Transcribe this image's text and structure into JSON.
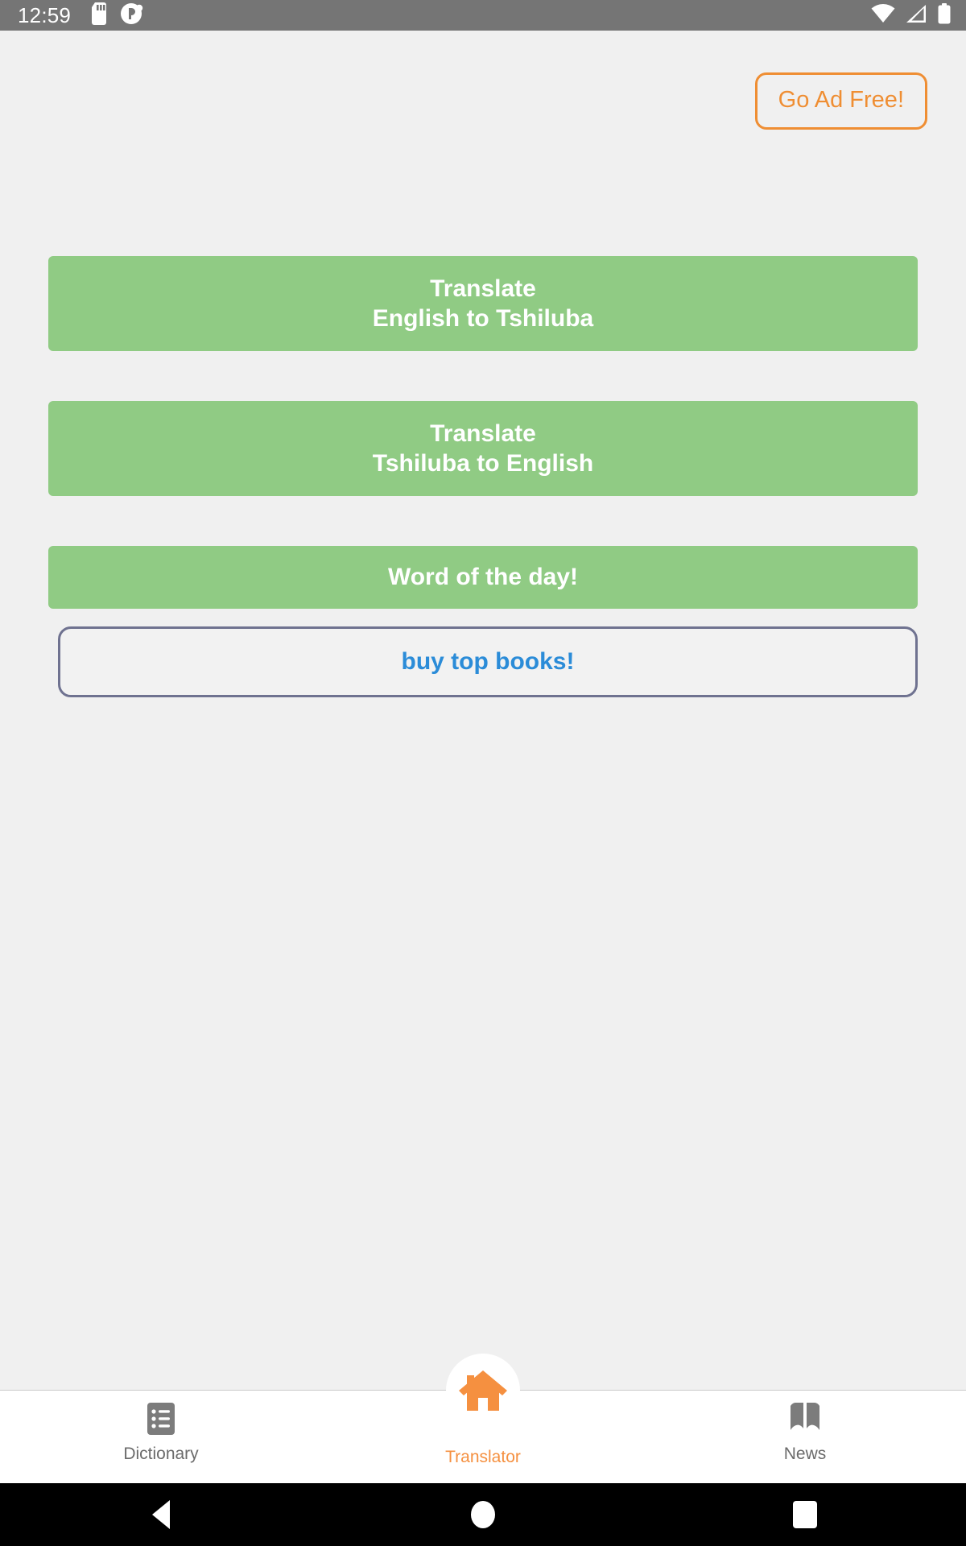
{
  "status_bar": {
    "time": "12:59",
    "left_icons": [
      "sd-card-icon",
      "circle-app-icon"
    ],
    "right_icons": [
      "wifi-icon",
      "cellular-signal-icon",
      "battery-icon"
    ],
    "background_color": "#757575",
    "foreground_color": "#ffffff"
  },
  "header": {
    "ad_free_button": {
      "label": "Go Ad Free!",
      "text_color": "#ef8e33",
      "border_color": "#ef8e33"
    }
  },
  "main": {
    "background_color": "#f0f0f0",
    "primary_color": "#90cb84",
    "buttons": [
      {
        "name": "translate-english-to-tshiluba",
        "line1": "Translate",
        "line2": "English to Tshiluba",
        "style": "filled-green",
        "background_color": "#90cb84",
        "text_color": "#ffffff"
      },
      {
        "name": "translate-tshiluba-to-english",
        "line1": "Translate",
        "line2": "Tshiluba to English",
        "style": "filled-green",
        "background_color": "#90cb84",
        "text_color": "#ffffff"
      },
      {
        "name": "word-of-the-day",
        "line1": "Word of the day!",
        "line2": "",
        "style": "filled-green",
        "background_color": "#90cb84",
        "text_color": "#ffffff"
      }
    ],
    "link_button": {
      "name": "buy-top-books",
      "label": "buy top books!",
      "text_color": "#2b8cd8",
      "border_color": "#6f7290",
      "background_color": "#f2f2f2"
    }
  },
  "bottom_nav": {
    "active_index": 1,
    "active_color": "#f59040",
    "inactive_color": "#6b6b6b",
    "background_color": "#ffffff",
    "items": [
      {
        "label": "Dictionary",
        "icon": "list-document-icon",
        "active": false
      },
      {
        "label": "Translator",
        "icon": "home-icon",
        "active": true
      },
      {
        "label": "News",
        "icon": "open-book-icon",
        "active": false
      }
    ]
  },
  "system_nav": {
    "background_color": "#000000",
    "buttons": [
      {
        "name": "back",
        "icon": "back-triangle-icon"
      },
      {
        "name": "home",
        "icon": "home-circle-icon"
      },
      {
        "name": "recents",
        "icon": "recents-square-icon"
      }
    ]
  }
}
